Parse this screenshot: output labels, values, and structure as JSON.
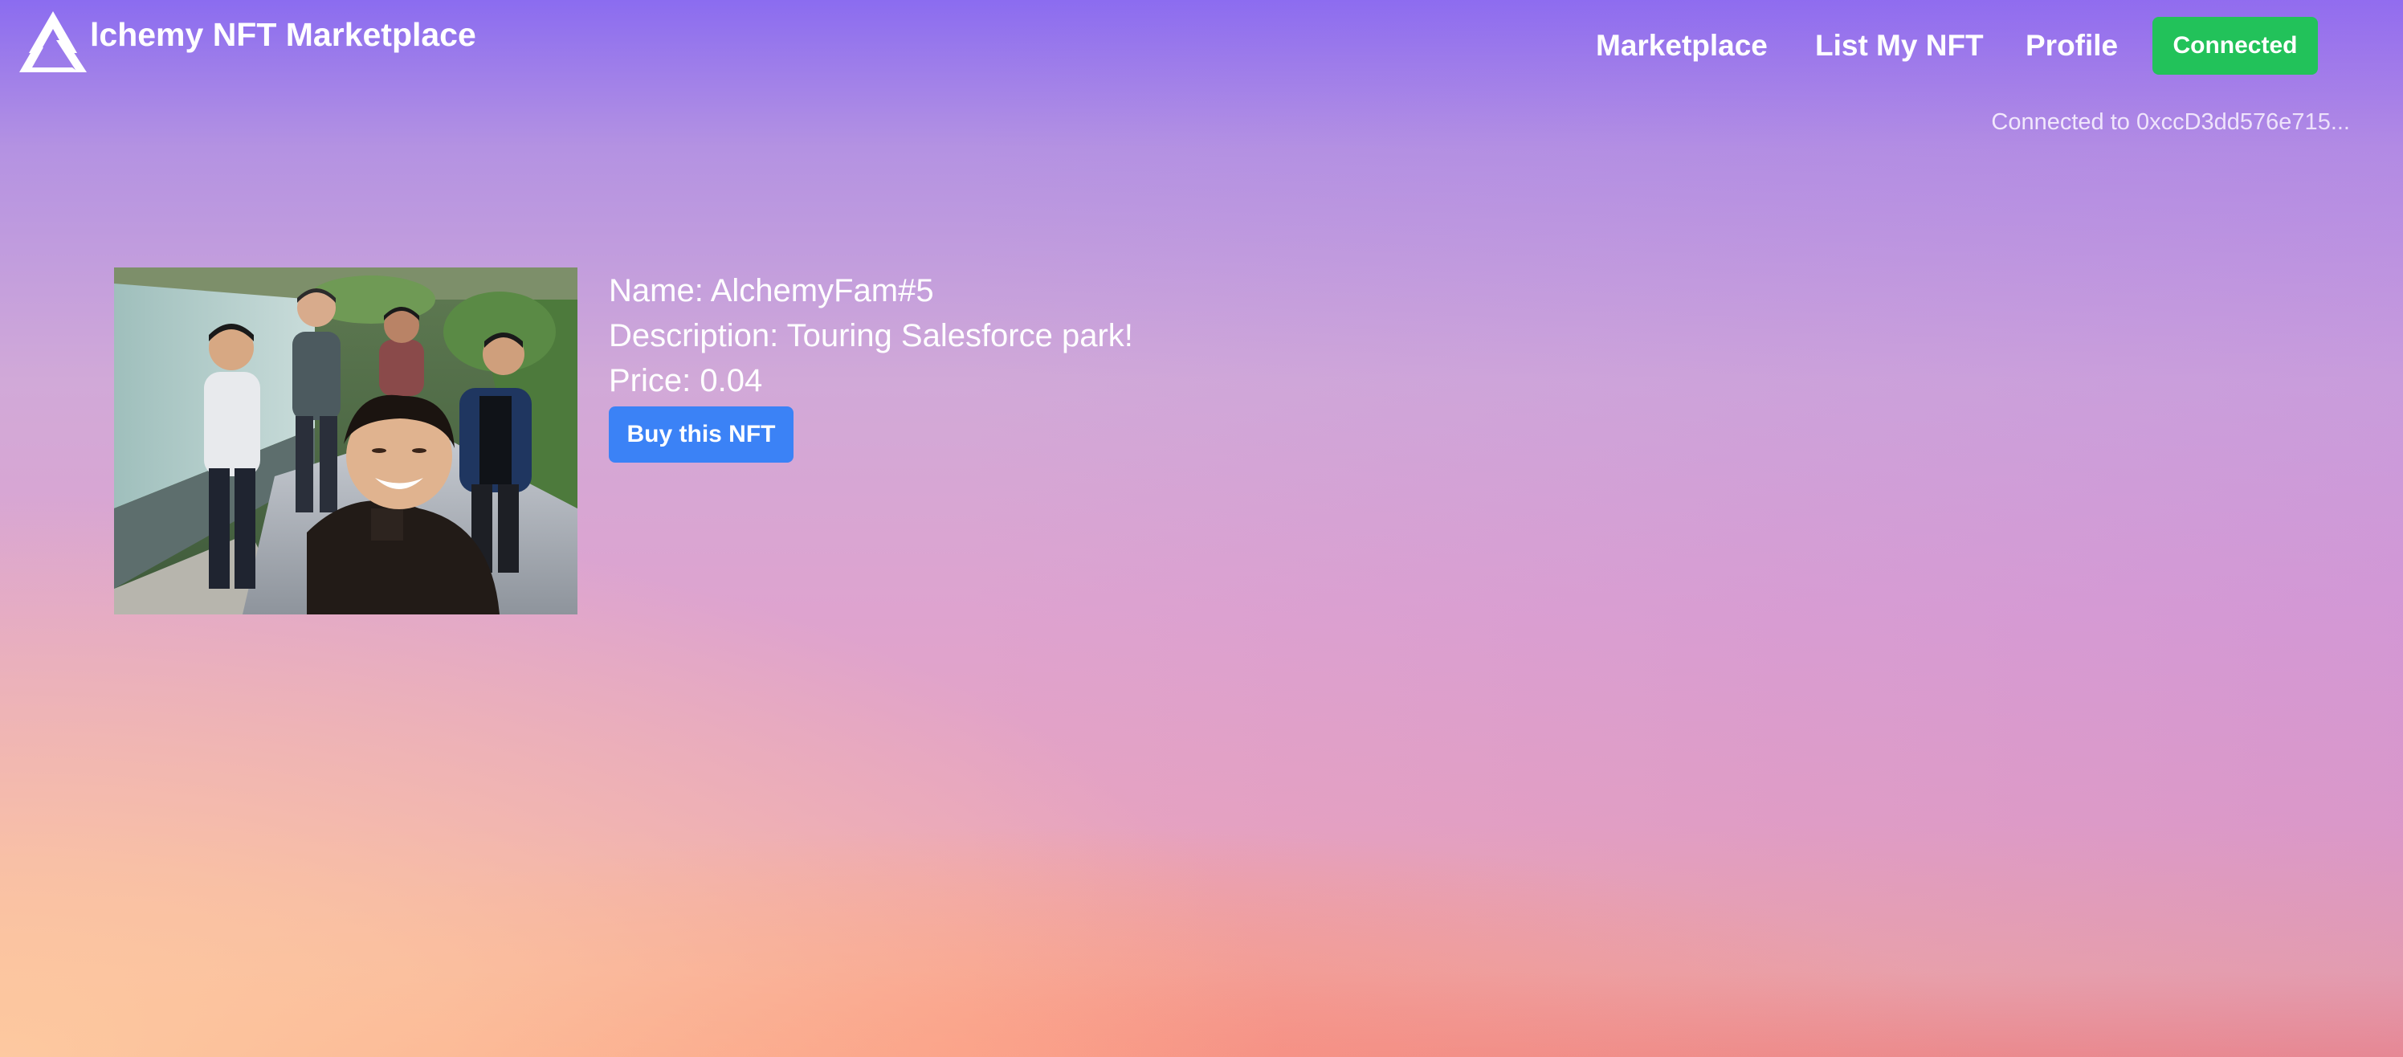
{
  "nav": {
    "brand": "lchemy NFT Marketplace",
    "links": [
      "Marketplace",
      "List My NFT",
      "Profile"
    ],
    "connect_button": "Connected",
    "connected_info": "Connected to 0xccD3dd576e715..."
  },
  "nft": {
    "name_line": "Name: AlchemyFam#5",
    "description_line": "Description: Touring Salesforce park!",
    "price_line": "Price: 0.04",
    "buy_button": "Buy this NFT"
  },
  "colors": {
    "connected_button": "#22c25a",
    "buy_button": "#3b82f6",
    "text": "#ffffff"
  }
}
